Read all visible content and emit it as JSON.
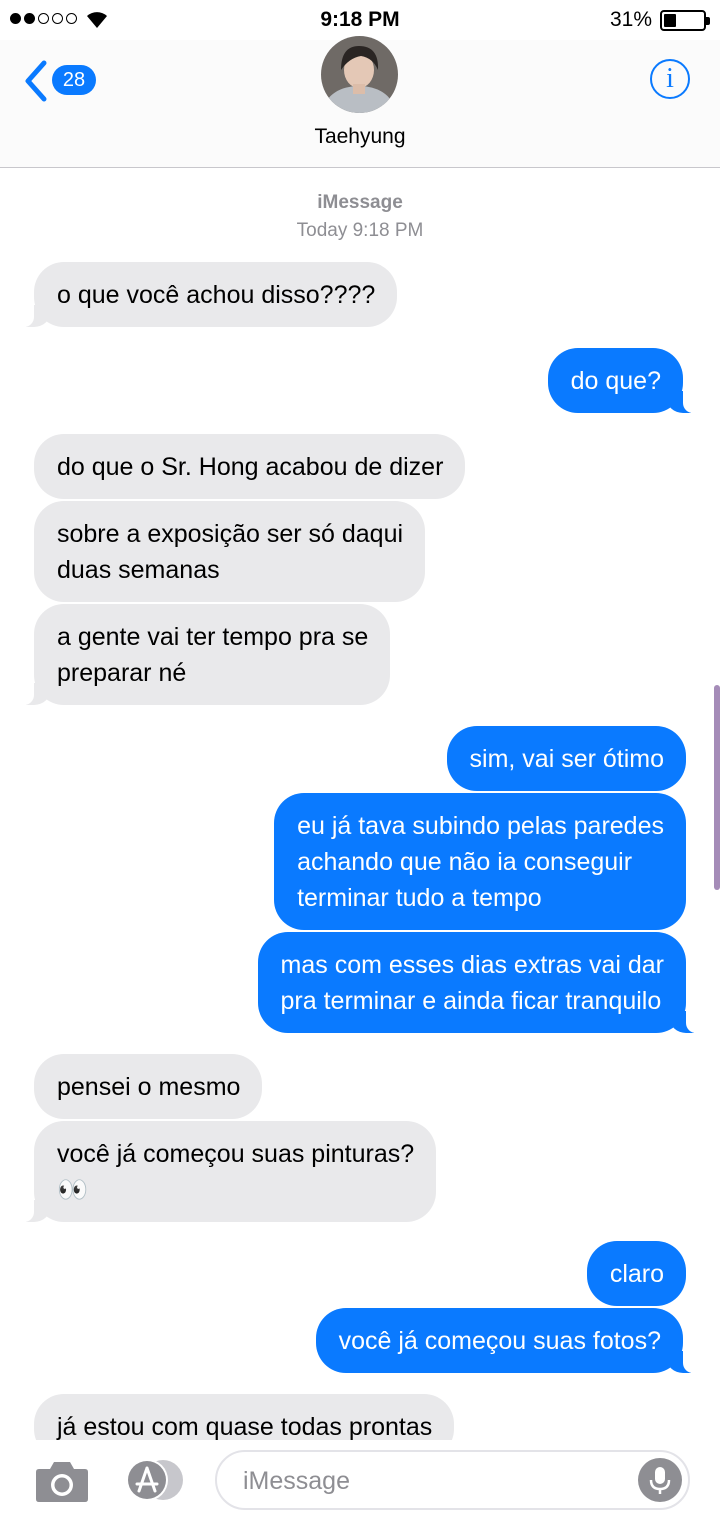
{
  "status_bar": {
    "time": "9:18 PM",
    "battery_percent": "31%",
    "signal_bars": 2,
    "signal_total": 5,
    "battery_level": 0.31
  },
  "header": {
    "back_badge": "28",
    "contact_name": "Taehyung",
    "info_icon": "i"
  },
  "conversation": {
    "service": "iMessage",
    "timestamp": "Today 9:18 PM",
    "messages": [
      {
        "from": "them",
        "text": "o que você achou disso????"
      },
      {
        "from": "me",
        "text": "do que?"
      },
      {
        "from": "them",
        "text": "do que o Sr. Hong acabou de dizer"
      },
      {
        "from": "them",
        "text": "sobre a exposição ser só daqui\nduas semanas"
      },
      {
        "from": "them",
        "text": "a gente vai ter tempo pra se\npreparar né"
      },
      {
        "from": "me",
        "text": "sim, vai ser ótimo"
      },
      {
        "from": "me",
        "text": "eu já tava subindo pelas paredes\nachando que não ia conseguir\nterminar tudo a tempo"
      },
      {
        "from": "me",
        "text": "mas com esses dias extras vai dar\npra terminar e ainda ficar tranquilo"
      },
      {
        "from": "them",
        "text": "pensei o mesmo"
      },
      {
        "from": "them",
        "text": "você já começou suas pinturas?\n👀"
      },
      {
        "from": "me",
        "text": "claro"
      },
      {
        "from": "me",
        "text": "você já começou suas fotos?"
      },
      {
        "from": "them",
        "text": "já estou com quase todas prontas"
      }
    ]
  },
  "input_bar": {
    "placeholder": "iMessage",
    "camera_icon": "camera-icon",
    "apps_icon": "app-store-icon",
    "mic_icon": "microphone-icon"
  },
  "colors": {
    "accent": "#0a7aff",
    "incoming_bubble": "#e9e9eb",
    "secondary_text": "#8e8e93"
  }
}
